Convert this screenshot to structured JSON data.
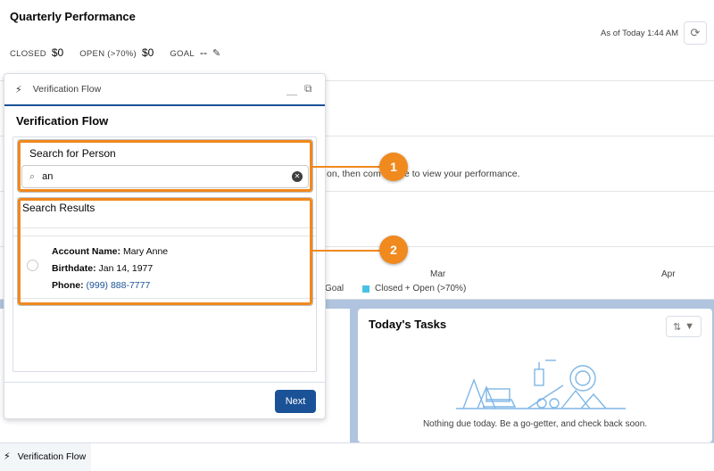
{
  "performance": {
    "title": "Quarterly Performance",
    "closed_label": "CLOSED",
    "closed_value": "$0",
    "open_label": "OPEN (>70%)",
    "open_value": "$0",
    "goal_label": "GOAL",
    "goal_value": "--",
    "as_of": "As of Today 1:44 AM",
    "chart_message": "on, then com   k here to view your performance.",
    "ticks": [
      "Mar",
      "Apr"
    ],
    "legend_goal": "Goal",
    "legend_closed_open": "Closed + Open (>70%)"
  },
  "tasks": {
    "title": "Today's Tasks",
    "empty_message": "Nothing due today. Be a go-getter, and check back soon."
  },
  "flow_panel": {
    "header_title": "Verification Flow",
    "title": "Verification Flow",
    "search_label": "Search for Person",
    "search_value": "an",
    "results_label": "Search Results",
    "result": {
      "account_label": "Account Name:",
      "account_value": "Mary Anne",
      "birthdate_label": "Birthdate:",
      "birthdate_value": "Jan 14, 1977",
      "phone_label": "Phone:",
      "phone_value": "(999) 888-7777"
    },
    "next_label": "Next"
  },
  "utility_bar": {
    "item_label": "Verification Flow"
  },
  "callouts": [
    "1",
    "2"
  ],
  "colors": {
    "accent": "#f0891e",
    "brand": "#1b5297",
    "legend_series": "#4bc0e6"
  }
}
